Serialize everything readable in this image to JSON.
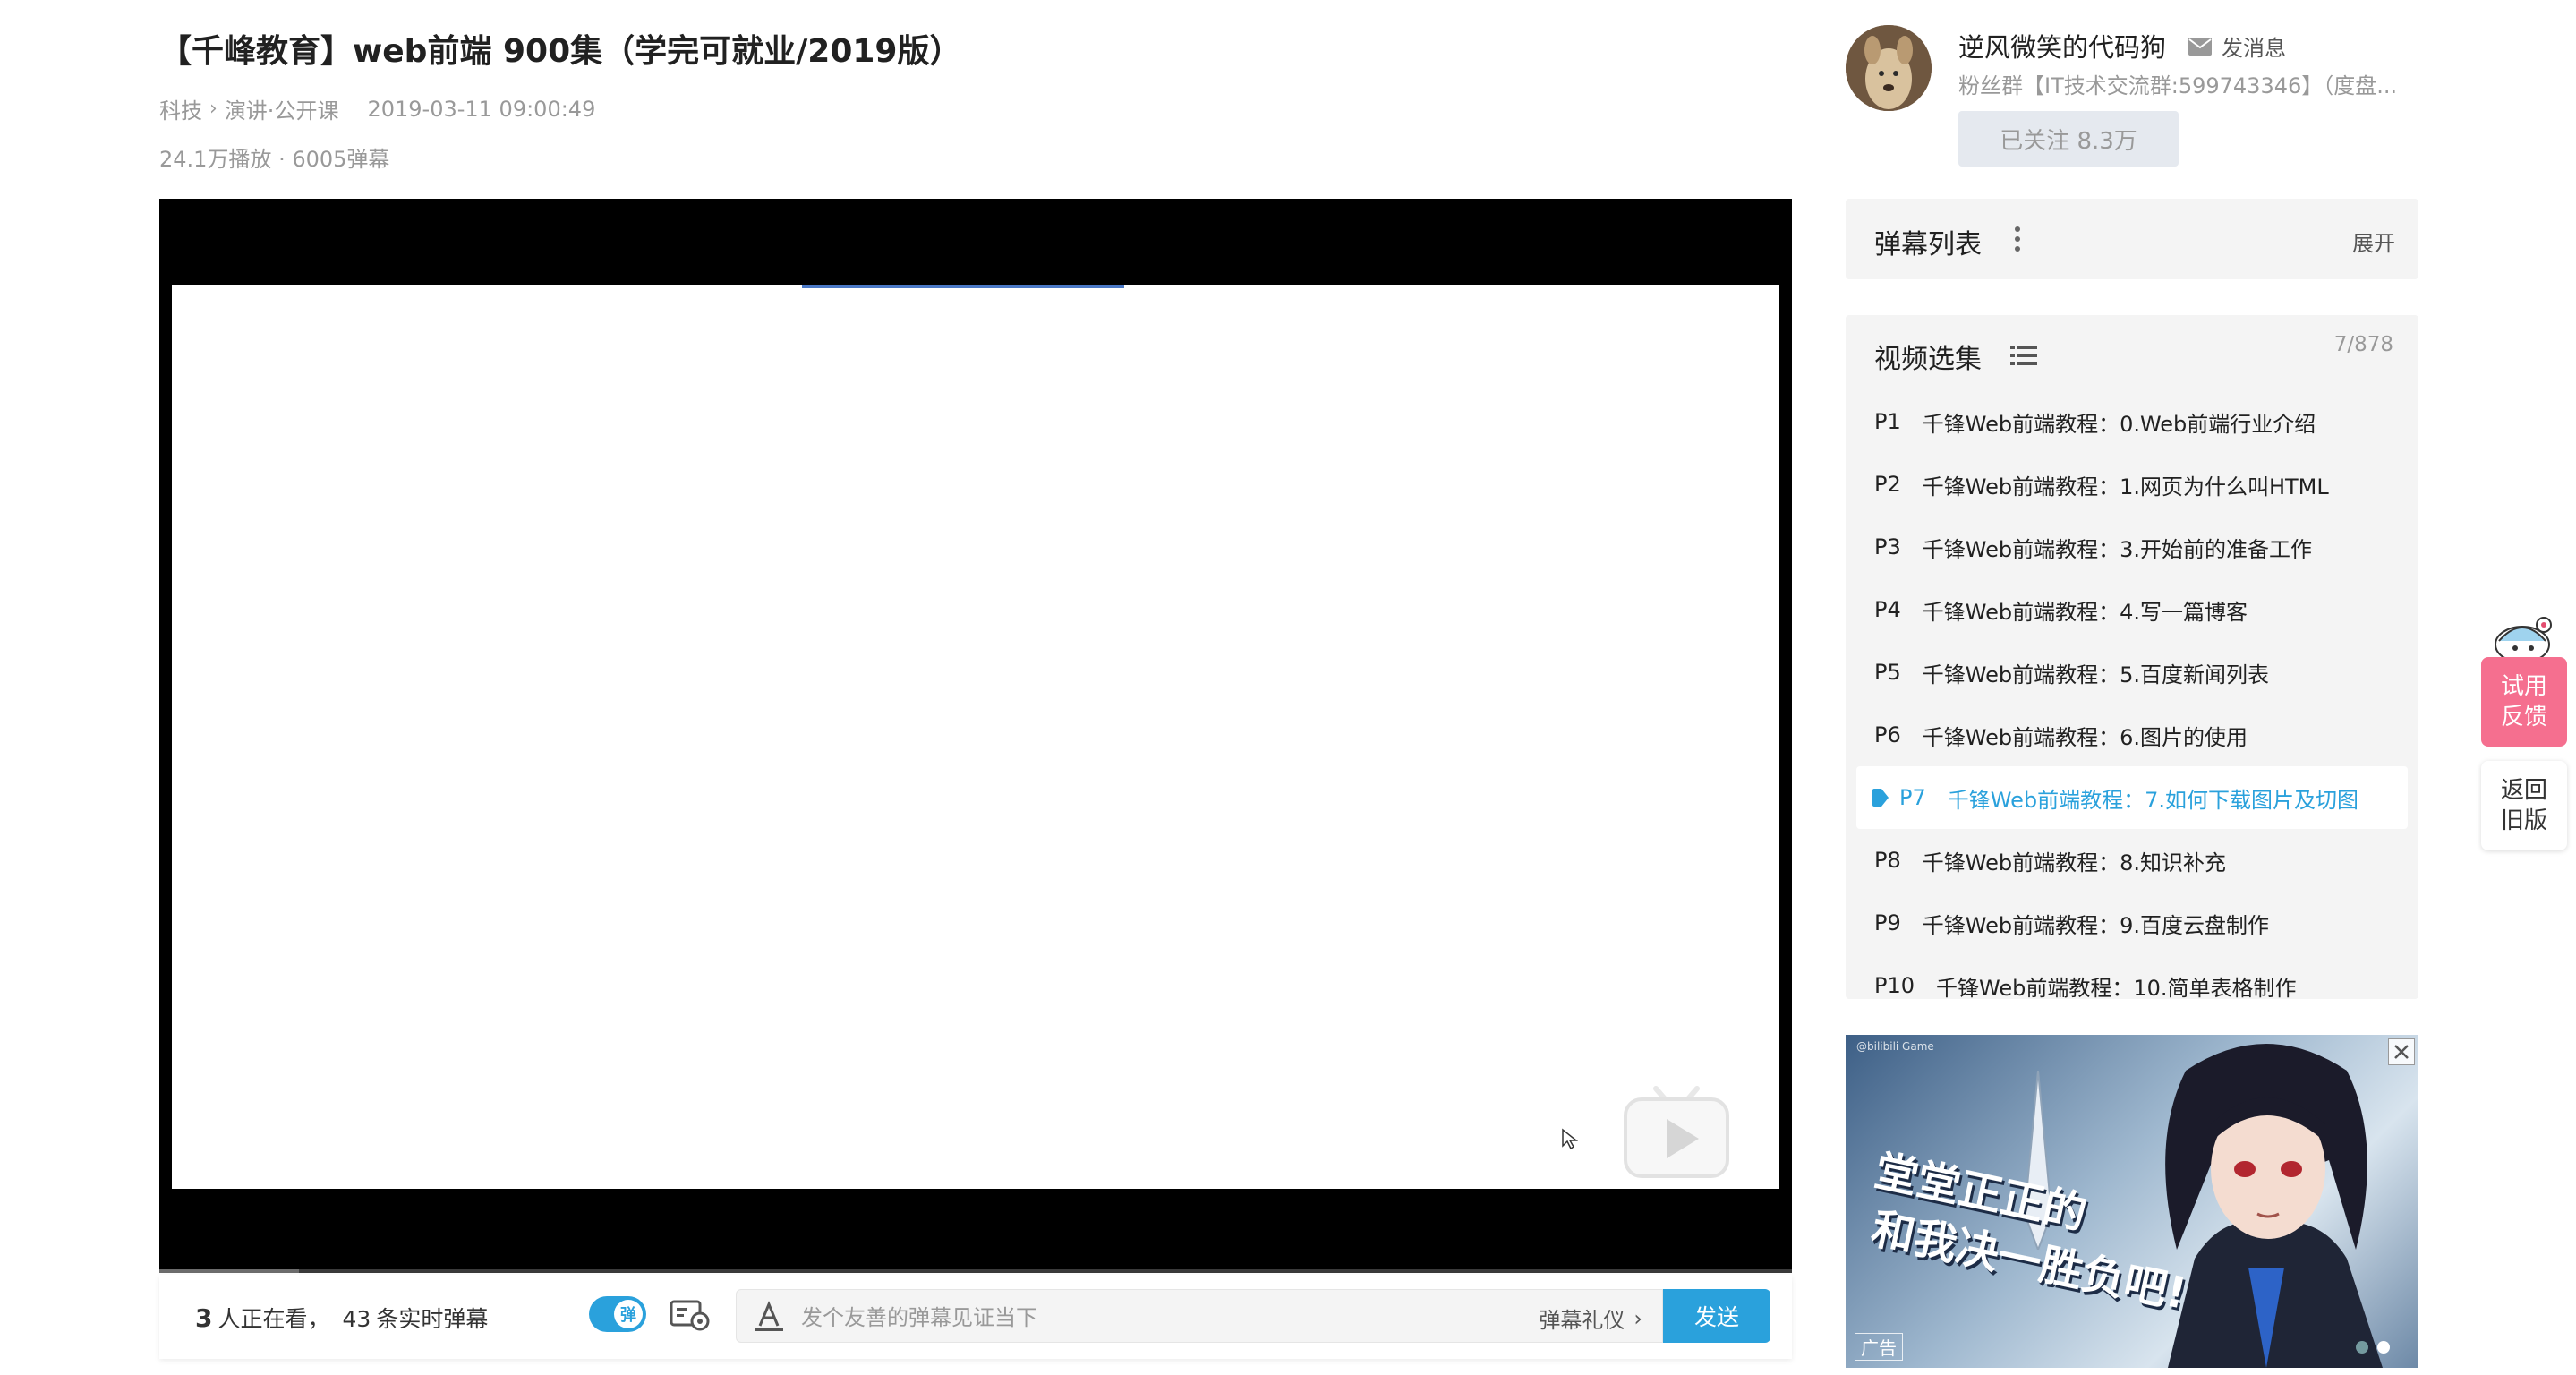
{
  "video": {
    "title": "【千峰教育】web前端 900集（学完可就业/2019版）",
    "category": "科技",
    "breadcrumb_sep": "›",
    "subcategory": "演讲·公开课",
    "date": "2019-03-11 09:00:49",
    "stats": "24.1万播放 · 6005弹幕"
  },
  "sendbar": {
    "viewers_count": "3",
    "viewers_text": "人正在看，",
    "danmaku_count": "43",
    "danmaku_text": "条实时弹幕",
    "toggle_label": "弹",
    "input_placeholder": "发个友善的弹幕见证当下",
    "etiquette": "弹幕礼仪",
    "etiquette_chevron": "›",
    "send": "发送"
  },
  "uploader": {
    "name": "逆风微笑的代码狗",
    "message": "发消息",
    "desc": "粉丝群【IT技术交流群:599743346】（度盘...",
    "follow": "已关注 8.3万"
  },
  "danmaku_panel": {
    "title": "弹幕列表",
    "expand": "展开"
  },
  "episodes": {
    "title": "视频选集",
    "count": "7/878",
    "items": [
      {
        "p": "P1",
        "title": "千锋Web前端教程：0.Web前端行业介绍"
      },
      {
        "p": "P2",
        "title": "千锋Web前端教程：1.网页为什么叫HTML"
      },
      {
        "p": "P3",
        "title": "千锋Web前端教程：3.开始前的准备工作"
      },
      {
        "p": "P4",
        "title": "千锋Web前端教程：4.写一篇博客"
      },
      {
        "p": "P5",
        "title": "千锋Web前端教程：5.百度新闻列表"
      },
      {
        "p": "P6",
        "title": "千锋Web前端教程：6.图片的使用"
      },
      {
        "p": "P7",
        "title": "千锋Web前端教程：7.如何下载图片及切图"
      },
      {
        "p": "P8",
        "title": "千锋Web前端教程：8.知识补充"
      },
      {
        "p": "P9",
        "title": "千锋Web前端教程：9.百度云盘制作"
      },
      {
        "p": "P10",
        "title": "千锋Web前端教程：10.简单表格制作"
      }
    ]
  },
  "ad": {
    "brand": "@bilibili Game",
    "line1": "堂堂正正的",
    "line2": "和我决一胜负吧!",
    "label": "广告"
  },
  "side": {
    "feedback_1": "试用",
    "feedback_2": "反馈",
    "oldver_1": "返回",
    "oldver_2": "旧版"
  },
  "colors": {
    "accent": "#2aa1dc",
    "feedback": "#f56f8f"
  }
}
